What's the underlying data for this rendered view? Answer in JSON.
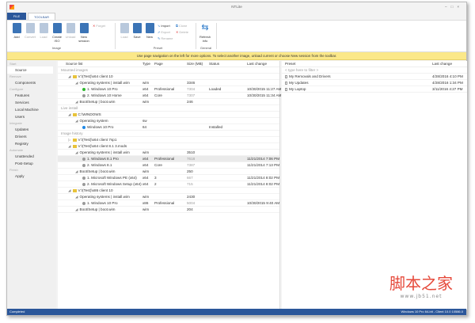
{
  "window": {
    "title": "NTLite"
  },
  "tabs": [
    "FILE",
    "TOOLBAR"
  ],
  "ribbon": {
    "image_buttons": [
      {
        "label": "Add",
        "enabled": true
      },
      {
        "label": "Convert",
        "enabled": false
      },
      {
        "label": "Load",
        "enabled": false
      },
      {
        "label": "Create ISO",
        "enabled": true
      },
      {
        "label": "Unload",
        "enabled": false
      },
      {
        "label": "New session",
        "enabled": true
      }
    ],
    "forget": "Forget",
    "image_group": "Image",
    "preset_buttons": [
      {
        "label": "Load",
        "enabled": false
      },
      {
        "label": "Save",
        "enabled": true
      },
      {
        "label": "New",
        "enabled": true
      }
    ],
    "preset_small": [
      {
        "label": "Import",
        "enabled": true
      },
      {
        "label": "Export",
        "enabled": false
      },
      {
        "label": "Rename",
        "enabled": false
      },
      {
        "label": "Clone",
        "enabled": false
      },
      {
        "label": "Delete",
        "enabled": false
      }
    ],
    "preset_group": "Preset",
    "refresh": "Refresh info",
    "general_group": "General"
  },
  "notice": "Use page navigation on the left for more options. To select another image, unload current or choose New session from the toolbar.",
  "sidebar": [
    {
      "header": "Start",
      "items": [
        "Source"
      ]
    },
    {
      "header": "Remove",
      "items": [
        "Components"
      ]
    },
    {
      "header": "Configure",
      "items": [
        "Features",
        "Services",
        "Local Machine",
        "Users"
      ]
    },
    {
      "header": "Integrate",
      "items": [
        "Updates",
        "Drivers",
        "Registry"
      ]
    },
    {
      "header": "Automate",
      "items": [
        "Unattended",
        "Post-Setup"
      ]
    },
    {
      "header": "Finish",
      "items": [
        "Apply"
      ]
    }
  ],
  "table": {
    "columns": [
      "Source list",
      "Type",
      "Page",
      "Size (MB)",
      "Status",
      "Last change"
    ],
    "rows": [
      {
        "l": 0,
        "kind": "group",
        "name": "Mounted images"
      },
      {
        "l": 1,
        "kind": "folder",
        "name": "V:\\(Test)\\x64 client 10"
      },
      {
        "l": 2,
        "name": "Operating systems  |  install.wim",
        "type": "wim",
        "size": "3346"
      },
      {
        "l": 3,
        "kind": "green",
        "name": "1. Windows 10 Pro",
        "type": "x64",
        "page": "Professional",
        "size": "7304",
        "status": "Loaded",
        "date": "10/30/2015 11:27 AM"
      },
      {
        "l": 3,
        "kind": "gray",
        "name": "2. Windows 10 Home",
        "type": "x64",
        "page": "Core",
        "size": "7307",
        "date": "10/30/2015 11:34 AM"
      },
      {
        "l": 2,
        "name": "Boot/Setup  |  boot.wim",
        "type": "wim",
        "size": "246"
      },
      {
        "l": 0,
        "kind": "group",
        "name": "Live install"
      },
      {
        "l": 1,
        "kind": "folder",
        "name": "C:\\WINDOWS"
      },
      {
        "l": 2,
        "name": "Operating system",
        "type": "sw"
      },
      {
        "l": 3,
        "kind": "blue",
        "name": "Windows 10 Pro",
        "type": "64",
        "status": "Installed"
      },
      {
        "l": 0,
        "kind": "group",
        "name": "Image history"
      },
      {
        "l": 1,
        "kind": "folder",
        "name": "V:\\(Test)\\x64 client 7sp1"
      },
      {
        "l": 1,
        "kind": "folder",
        "name": "V:\\(Test)\\x64 client 8.1 3.mods"
      },
      {
        "l": 2,
        "name": "Operating systems  |  install.wim",
        "type": "wim",
        "size": "3510"
      },
      {
        "l": 3,
        "kind": "gray",
        "hl": true,
        "name": "1. Windows 8.1 Pro",
        "type": "x64",
        "page": "Professional",
        "size": "7618",
        "date": "11/21/2014 7:06 PM"
      },
      {
        "l": 3,
        "kind": "gray",
        "name": "2. Windows 8.1",
        "type": "x64",
        "page": "Core",
        "size": "7387",
        "date": "11/21/2014 7:13 PM"
      },
      {
        "l": 2,
        "name": "Boot/Setup  |  boot.wim",
        "type": "wim",
        "size": "250"
      },
      {
        "l": 3,
        "kind": "gray",
        "name": "1. Microsoft Windows PE (x64)",
        "type": "x64",
        "page": "3",
        "size": "667",
        "date": "11/21/2014 8:02 PM"
      },
      {
        "l": 3,
        "kind": "gray",
        "name": "2. Microsoft Windows Setup (x64)",
        "type": "x64",
        "page": "2",
        "size": "715",
        "date": "11/21/2014 8:02 PM"
      },
      {
        "l": 1,
        "kind": "folder",
        "name": "V:\\(Test)\\x86 client 10"
      },
      {
        "l": 2,
        "name": "Operating systems  |  install.wim",
        "type": "wim",
        "size": "2430"
      },
      {
        "l": 3,
        "kind": "gray",
        "name": "1. Windows 10 Pro",
        "type": "x86",
        "page": "Professional",
        "size": "5004",
        "date": "10/30/2015 9:40 AM"
      },
      {
        "l": 2,
        "name": "Boot/Setup  |  boot.wim",
        "type": "wim",
        "size": "204"
      }
    ]
  },
  "presets": {
    "columns": [
      "Preset",
      "Last change"
    ],
    "filter_placeholder": "< type here to filter >",
    "rows": [
      {
        "name": "My Removals and Drivers",
        "date": "4/28/2016 4:10 PM"
      },
      {
        "name": "My Updates",
        "date": "4/28/2016 1:34 PM"
      },
      {
        "name": "My Laptop",
        "date": "3/11/2016 4:27 PM"
      }
    ]
  },
  "status": {
    "left": "Completed",
    "right": "Windows 10 Pro 64-bit - Client 10.0 10586.0"
  },
  "watermark": {
    "text": "脚本之家",
    "url": "www.jb51.net"
  },
  "colors": {
    "accent": "#2b579a",
    "notice": "#fbe889",
    "loaded": "#2eb82e",
    "live": "#1e88e5"
  }
}
